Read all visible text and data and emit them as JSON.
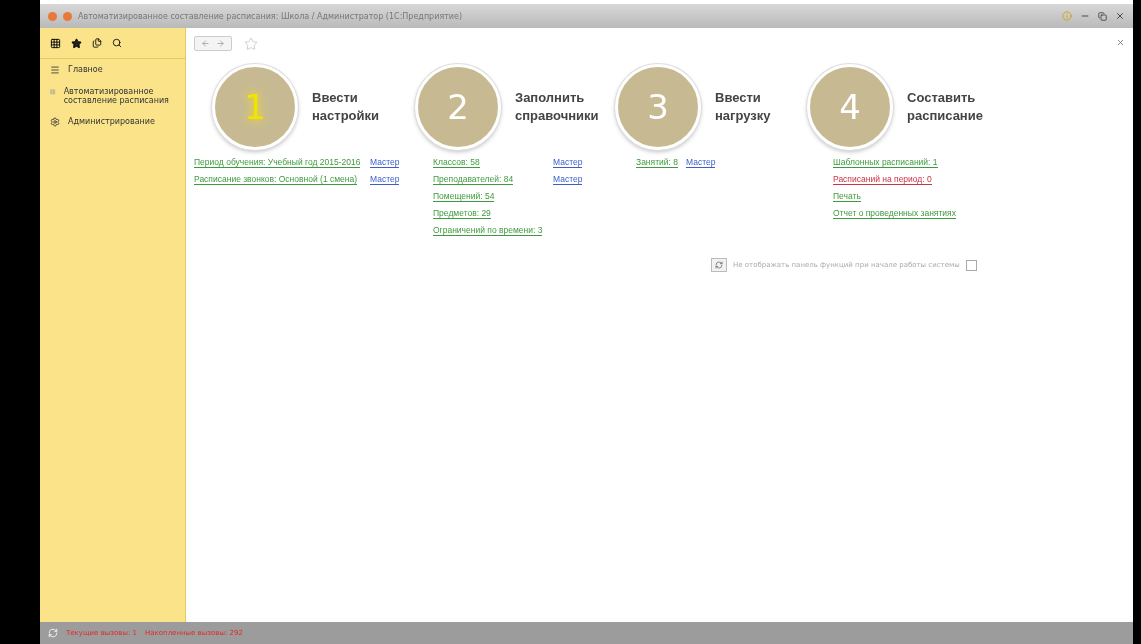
{
  "window": {
    "title": "Автоматизированное составление расписания: Школа / Администратор  (1С:Предприятие)"
  },
  "sidebar": {
    "items": [
      {
        "label": "Главное",
        "kind": "list"
      },
      {
        "label": "Автоматизированное составление расписания",
        "kind": "grid"
      },
      {
        "label": "Администрирование",
        "kind": "gear"
      }
    ]
  },
  "steps": [
    {
      "number": "1",
      "title": "Ввести настройки",
      "highlighted": true,
      "rows": [
        [
          {
            "text": "Период обучения: Учебный год 2015-2016",
            "color": "#3f9a3f"
          },
          {
            "text": "Мастер",
            "color": "#3a5fcd"
          }
        ],
        [
          {
            "text": "Расписание звонков: Основной (1 смена)",
            "color": "#3f9a3f"
          },
          {
            "text": "Мастер",
            "color": "#3a5fcd"
          }
        ]
      ]
    },
    {
      "number": "2",
      "title": "Заполнить справочники",
      "highlighted": false,
      "rows": [
        [
          {
            "text": "Классов: 58",
            "color": "#3f9a3f"
          },
          {
            "text": "Мастер",
            "color": "#3a5fcd"
          }
        ],
        [
          {
            "text": "Преподавателей: 84",
            "color": "#3f9a3f"
          },
          {
            "text": "Мастер",
            "color": "#3a5fcd"
          }
        ],
        [
          {
            "text": "Помещений: 54",
            "color": "#3f9a3f"
          }
        ],
        [
          {
            "text": "Предметов: 29",
            "color": "#3f9a3f"
          }
        ],
        [
          {
            "text": "Ограничений по времени: 3",
            "color": "#3f9a3f"
          }
        ]
      ]
    },
    {
      "number": "3",
      "title": "Ввести нагрузку",
      "highlighted": false,
      "rows": [
        [
          {
            "text": "Занятий: 8",
            "color": "#3f9a3f"
          },
          {
            "text": "Мастер",
            "color": "#3a5fcd"
          }
        ]
      ]
    },
    {
      "number": "4",
      "title": "Составить расписание",
      "highlighted": false,
      "rows": [
        [
          {
            "text": "Шаблонных расписаний: 1",
            "color": "#3f9a3f"
          }
        ],
        [
          {
            "text": "Расписаний на период: 0",
            "color": "#cc3344"
          }
        ],
        [
          {
            "text": "Печать",
            "color": "#3f9a3f"
          }
        ],
        [
          {
            "text": "Отчет о проведенных занятиях",
            "color": "#3f9a3f"
          }
        ]
      ]
    }
  ],
  "hide_panel": {
    "label": "Не отображать панель функций при начале работы системы",
    "checked": false
  },
  "status_bar": {
    "current_calls": "Текущие вызовы: 1",
    "total_calls": "Накопленные вызовы: 292"
  }
}
